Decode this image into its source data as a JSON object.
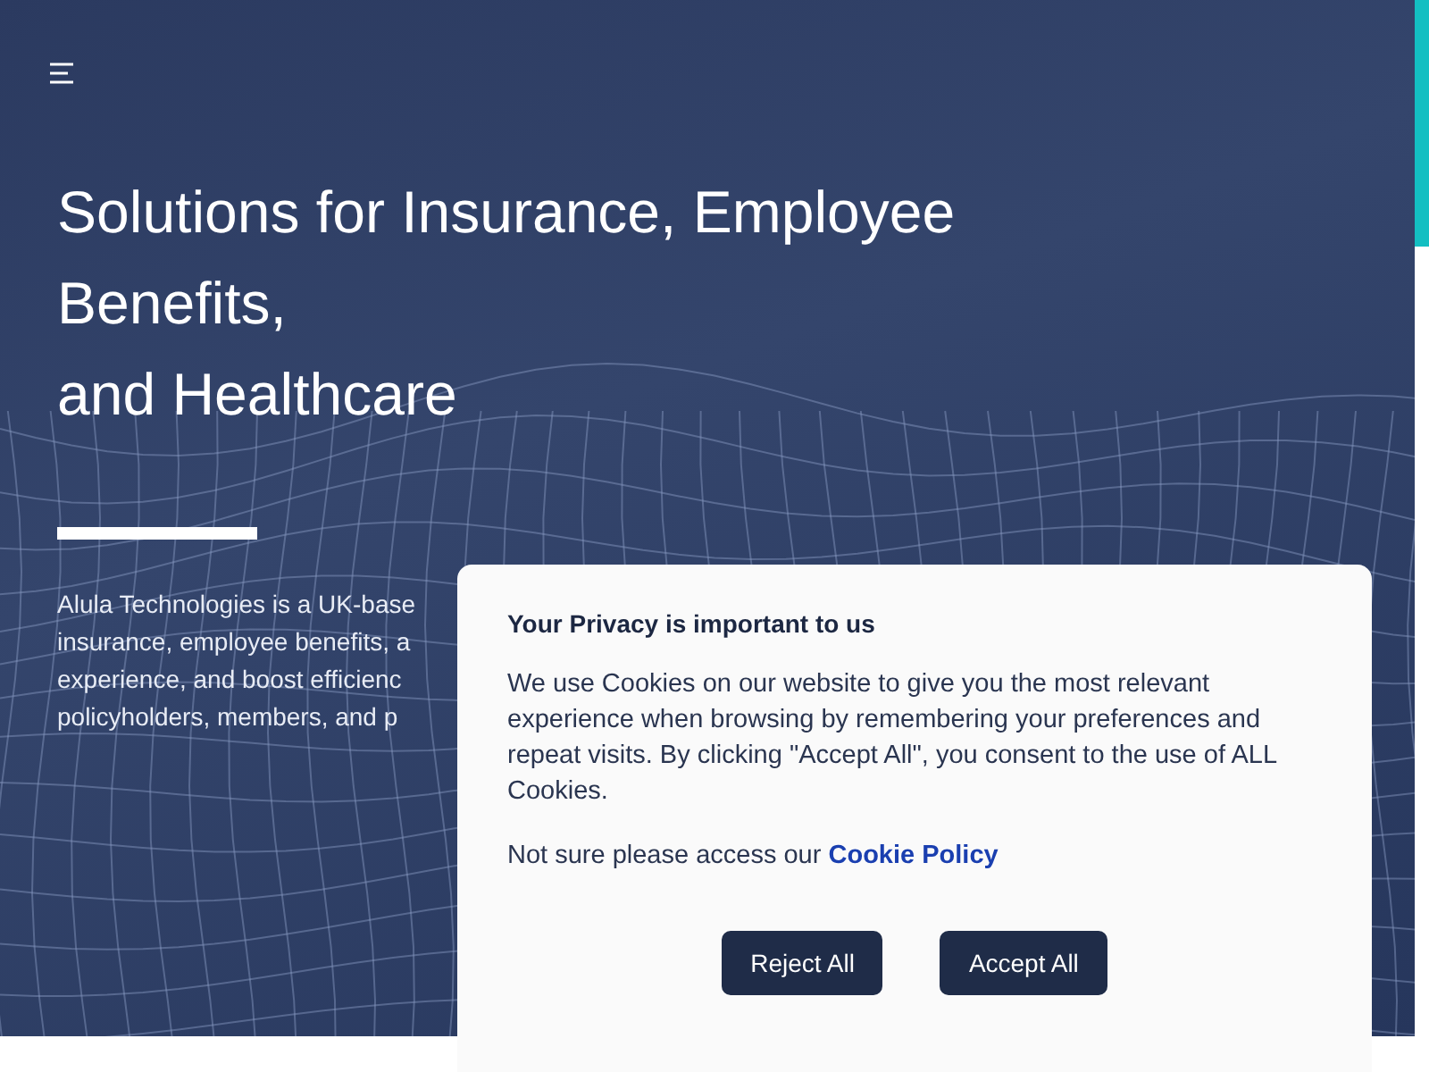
{
  "hero": {
    "title_lines": [
      "Solutions for Insurance, Employee Benefits,",
      "and Healthcare"
    ],
    "intro_lines": [
      "Alula Technologies is a UK-base",
      "insurance, employee benefits, a",
      "experience, and boost efficienc",
      "policyholders, members, and p"
    ]
  },
  "cookie_dialog": {
    "title": "Your Privacy is important to us",
    "body": "We use Cookies on our website to give you the most relevant experience when browsing by remembering your preferences and repeat visits. By clicking \"Accept All\", you consent to the use of ALL Cookies.",
    "policy_text": "Not sure please access our",
    "policy_link": "Cookie Policy",
    "buttons": [
      "Reject All",
      "Accept All"
    ]
  }
}
